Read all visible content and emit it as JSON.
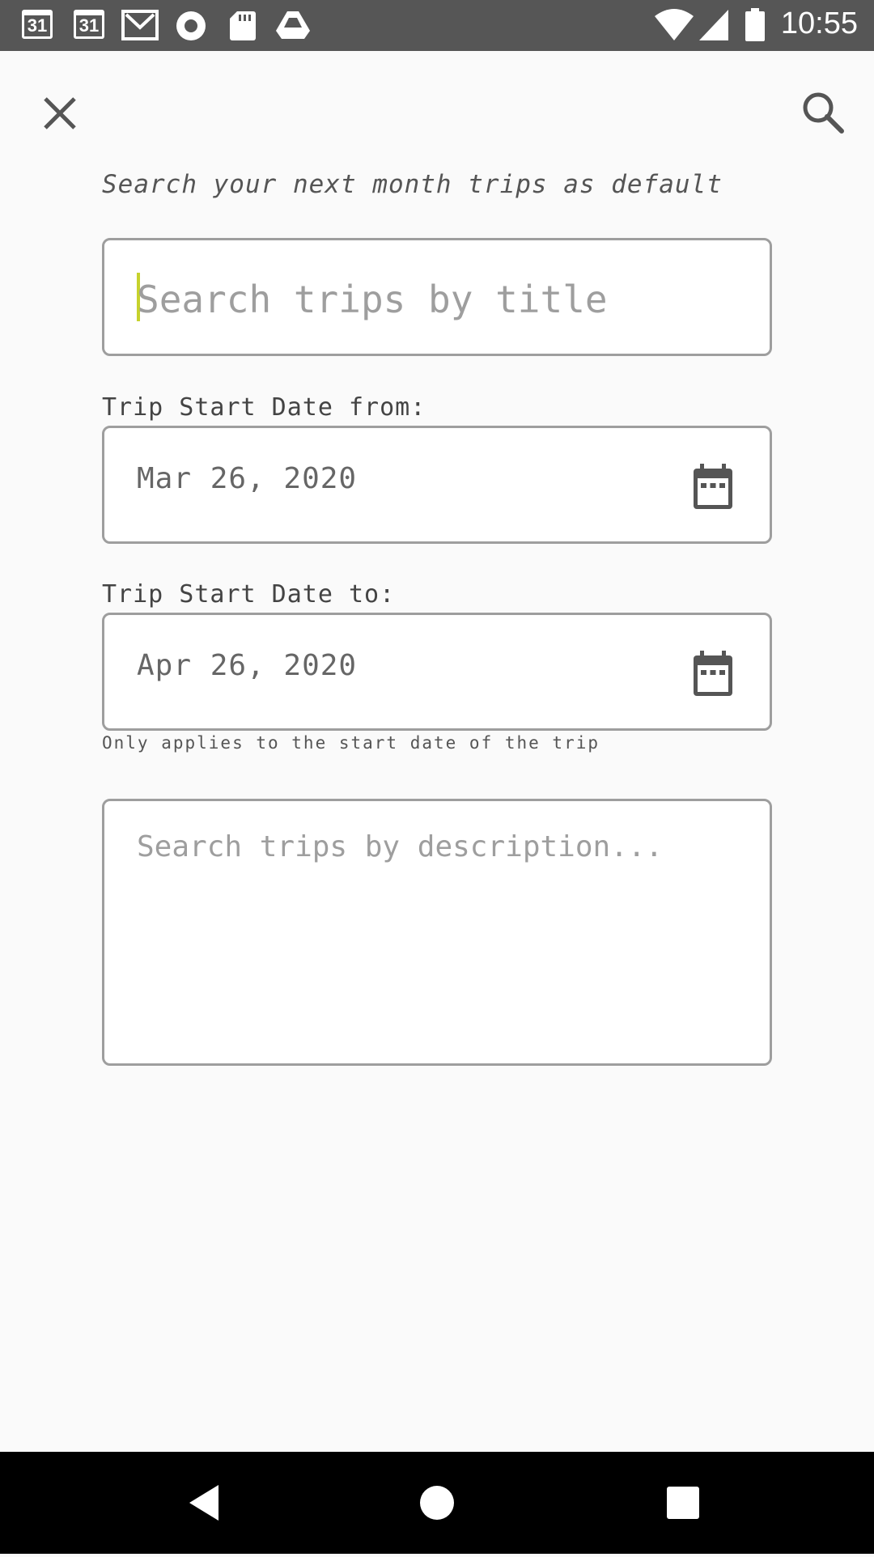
{
  "status_bar": {
    "time": "10:55",
    "notification_icons": [
      "calendar-icon",
      "calendar-icon",
      "gmail-icon",
      "record-icon",
      "sd-card-icon",
      "drive-icon"
    ],
    "calendar_badge_1": "31",
    "calendar_badge_2": "31",
    "system_icons": [
      "wifi-icon",
      "cell-signal-icon",
      "battery-icon"
    ]
  },
  "toolbar": {
    "close_icon": "close-icon",
    "search_icon": "search-icon"
  },
  "hint_text": "Search your next month trips as default",
  "title_search": {
    "placeholder": "Search trips by title",
    "value": ""
  },
  "start_from": {
    "label": "Trip Start Date from:",
    "value": "Mar 26, 2020",
    "icon": "calendar-icon"
  },
  "start_to": {
    "label": "Trip Start Date to:",
    "value": "Apr 26, 2020",
    "icon": "calendar-icon"
  },
  "helper_text": "Only applies to the start date of the trip",
  "description_search": {
    "placeholder": "Search trips by description...",
    "value": ""
  },
  "nav_bar": {
    "buttons": [
      "back-icon",
      "home-icon",
      "recents-icon"
    ]
  },
  "colors": {
    "status_bar_bg": "#565656",
    "background": "#fafafa",
    "caret": "#c6d22c",
    "border": "#9e9e9e"
  }
}
